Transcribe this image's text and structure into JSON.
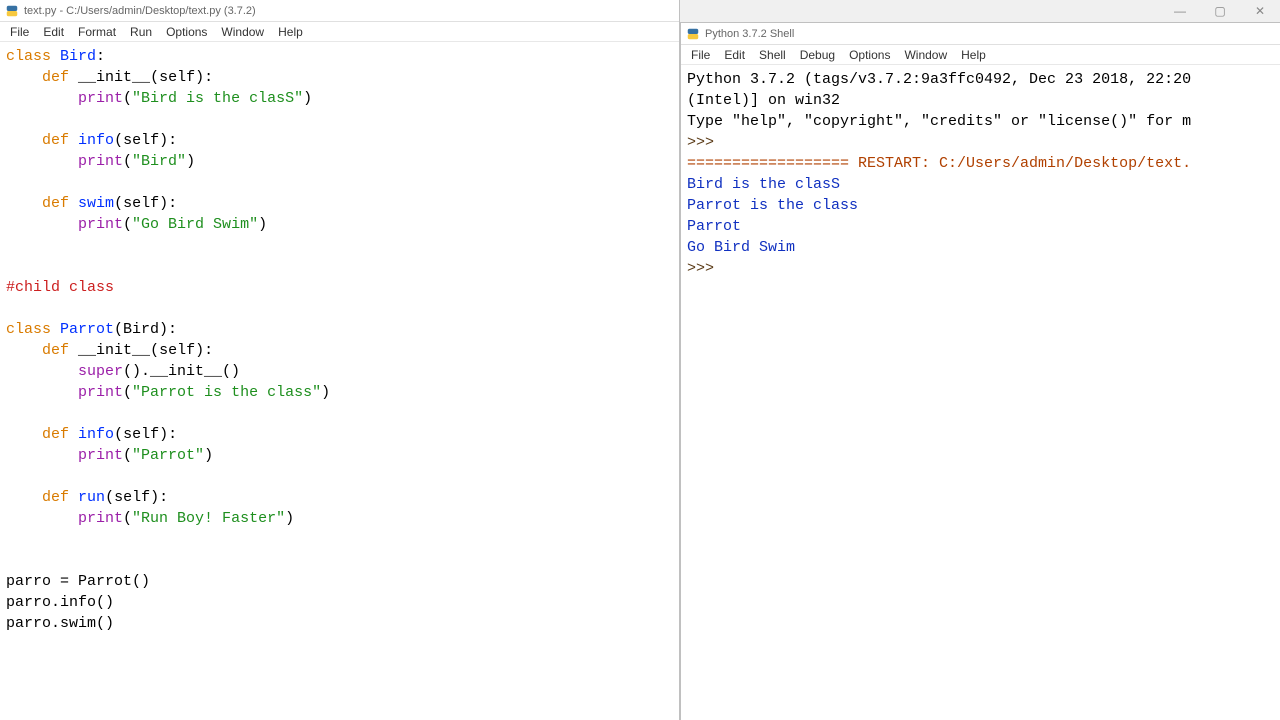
{
  "editor": {
    "title": "text.py - C:/Users/admin/Desktop/text.py (3.7.2)",
    "menus": [
      "File",
      "Edit",
      "Format",
      "Run",
      "Options",
      "Window",
      "Help"
    ],
    "code": {
      "l1_kw1": "class",
      "l1_name": "Bird",
      "l2_kw": "def",
      "l2_name": "__init__",
      "l2_args": "(self):",
      "l3_fn": "print",
      "l3_str": "\"Bird is the clasS\"",
      "l4_kw": "def",
      "l4_name": "info",
      "l4_args": "(self):",
      "l5_fn": "print",
      "l5_str": "\"Bird\"",
      "l6_kw": "def",
      "l6_name": "swim",
      "l6_args": "(self):",
      "l7_fn": "print",
      "l7_str": "\"Go Bird Swim\"",
      "comment": "#child class",
      "l8_kw": "class",
      "l8_name": "Parrot",
      "l8_paren": "(Bird):",
      "l9_kw": "def",
      "l9_name": "__init__",
      "l9_args": "(self):",
      "l10_fn": "super",
      "l10_rest": "().__init__()",
      "l11_fn": "print",
      "l11_str": "\"Parrot is the class\"",
      "l12_kw": "def",
      "l12_name": "info",
      "l12_args": "(self):",
      "l13_fn": "print",
      "l13_str": "\"Parrot\"",
      "l14_kw": "def",
      "l14_name": "run",
      "l14_args": "(self):",
      "l15_fn": "print",
      "l15_str": "\"Run Boy! Faster\"",
      "l16": "parro = Parrot()",
      "l17": "parro.info()",
      "l18": "parro.swim()"
    }
  },
  "shell": {
    "title": "Python 3.7.2 Shell",
    "menus": [
      "File",
      "Edit",
      "Shell",
      "Debug",
      "Options",
      "Window",
      "Help"
    ],
    "banner1": "Python 3.7.2 (tags/v3.7.2:9a3ffc0492, Dec 23 2018, 22:20",
    "banner2": "(Intel)] on win32",
    "banner3": "Type \"help\", \"copyright\", \"credits\" or \"license()\" for m",
    "prompt": ">>> ",
    "restart": "================== RESTART: C:/Users/admin/Desktop/text.",
    "out1": "Bird is the clasS",
    "out2": "Parrot is the class",
    "out3": "Parrot",
    "out4": "Go Bird Swim"
  },
  "winControls": {
    "min": "—",
    "max": "▢",
    "close": "✕"
  }
}
